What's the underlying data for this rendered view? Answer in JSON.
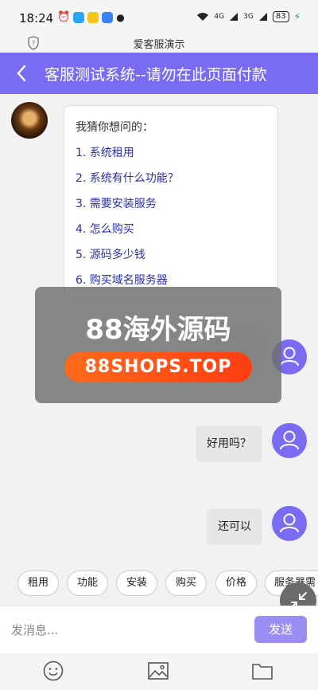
{
  "status_bar": {
    "time": "18:24",
    "net1": "4G",
    "net2": "3G",
    "battery": "83"
  },
  "url_bar": {
    "title": "爱客服演示"
  },
  "navbar": {
    "back_icon": "chevron-left-icon",
    "title": "客服测试系统--请勿在此页面付款"
  },
  "bot_message": {
    "title": "我猜你想问的：",
    "questions": [
      "1.  系统租用",
      "2.  系统有什么功能？",
      "3.  需要安装服务",
      "4.  怎么购买",
      "5.  源码多少钱",
      "6.  购买域名服务器"
    ]
  },
  "user_messages": [
    "好用吗？",
    "还可以"
  ],
  "watermark": {
    "title": "88海外源码",
    "subtitle": "88SHOPS.TOP"
  },
  "quick_replies": [
    "租用",
    "功能",
    "安装",
    "购买",
    "价格",
    "服务器需"
  ],
  "input": {
    "placeholder": "发消息...",
    "send_label": "发送"
  },
  "bottom_icons": [
    "emoji-icon",
    "image-icon",
    "folder-icon"
  ],
  "colors": {
    "accent": "#7a6cf2",
    "send": "#9a8ef5",
    "link": "#2a2fa8",
    "watermark_pill": "#ff5a1a"
  }
}
